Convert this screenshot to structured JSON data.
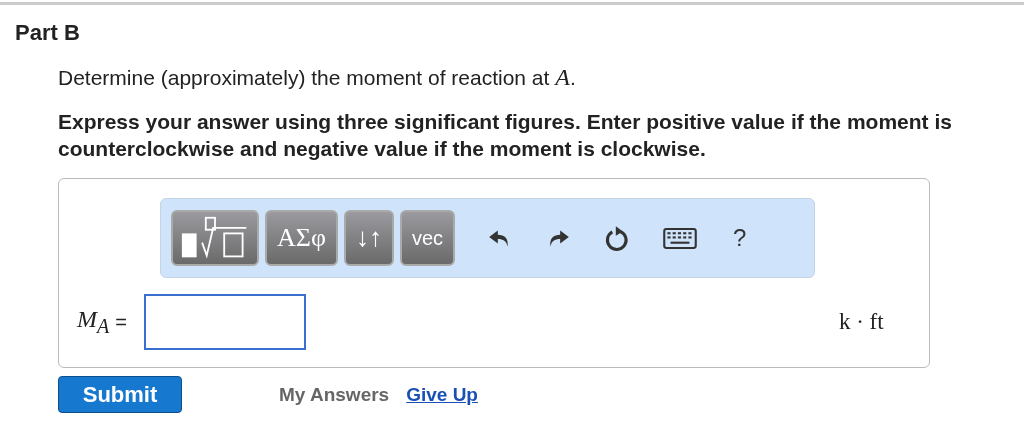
{
  "part": {
    "title": "Part B"
  },
  "prompt": "Determine (approximately) the moment of reaction at *A*.",
  "instructions": "Express your answer using three significant figures. Enter positive value if the moment is counterclockwise and negative value if the moment is clockwise.",
  "toolbar": [
    {
      "kind": "templates"
    },
    {
      "kind": "greek",
      "label": "ΑΣφ"
    },
    {
      "kind": "arrows",
      "label": "↓↑"
    },
    {
      "kind": "vector",
      "label": "vec"
    },
    {
      "kind": "undo"
    },
    {
      "kind": "redo"
    },
    {
      "kind": "reset"
    },
    {
      "kind": "keyboard"
    },
    {
      "kind": "help",
      "label": "?"
    }
  ],
  "answer": {
    "symbol": "M$_{A}$",
    "equals": "=",
    "units": "k · ft"
  },
  "actions": {
    "submit": "Submit",
    "my_answers": "My Answers",
    "give_up": "Give Up"
  }
}
